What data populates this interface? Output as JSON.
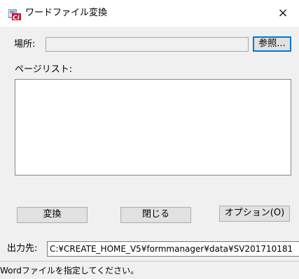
{
  "window": {
    "title": "ワードファイル変換",
    "close_glyph": "×",
    "app_icon": "word-ci-icon"
  },
  "location": {
    "label": "場所:",
    "value": "",
    "browse_label": "参照..."
  },
  "page_list": {
    "label": "ページリスト:",
    "items": []
  },
  "buttons": {
    "convert": "変換",
    "close": "閉じる",
    "options": "オプション(O)"
  },
  "output": {
    "label": "出力先:",
    "value": "C:¥CREATE_HOME_V5¥formmanager¥data¥SV201710181"
  },
  "status": {
    "message": "Wordファイルを指定してください。"
  },
  "colors": {
    "window_bg": "#f0f0f0",
    "titlebar_bg": "#ffffff",
    "focus_border": "#0078d7",
    "icon_red": "#c8102e",
    "icon_blue": "#2b5797"
  }
}
